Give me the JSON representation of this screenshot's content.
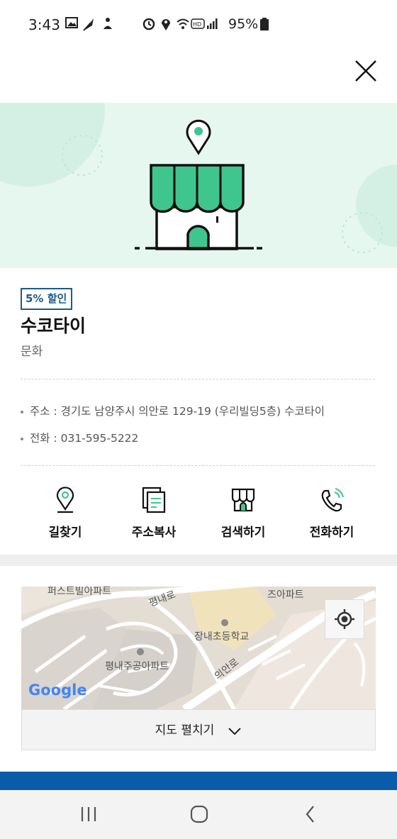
{
  "status_bar": {
    "time": "3:43",
    "battery": "95%"
  },
  "header": {
    "close_icon": "close-icon"
  },
  "store": {
    "badge": "5% 할인",
    "name": "수코타이",
    "category": "문화",
    "address": "주소 : 경기도 남양주시 의안로 129-19 (우리빌딩5층) 수코타이",
    "phone": "전화 : 031-595-5222",
    "accent_color": "#3fc68e",
    "badge_color": "#1e5a8a"
  },
  "actions": [
    {
      "label": "길찾기",
      "icon": "map-pin-icon"
    },
    {
      "label": "주소복사",
      "icon": "copy-icon"
    },
    {
      "label": "검색하기",
      "icon": "store-icon"
    },
    {
      "label": "전화하기",
      "icon": "phone-icon"
    }
  ],
  "map": {
    "labels": {
      "apt1": "퍼스트빌아파트",
      "road1": "평내로",
      "apt2": "즈아파트",
      "school": "장내초등학교",
      "apt3": "평내주공아파트",
      "road2": "의안로"
    },
    "google_logo": "Google",
    "expand_label": "지도 펼치기"
  },
  "bottom_bar_color": "#0a5cab"
}
